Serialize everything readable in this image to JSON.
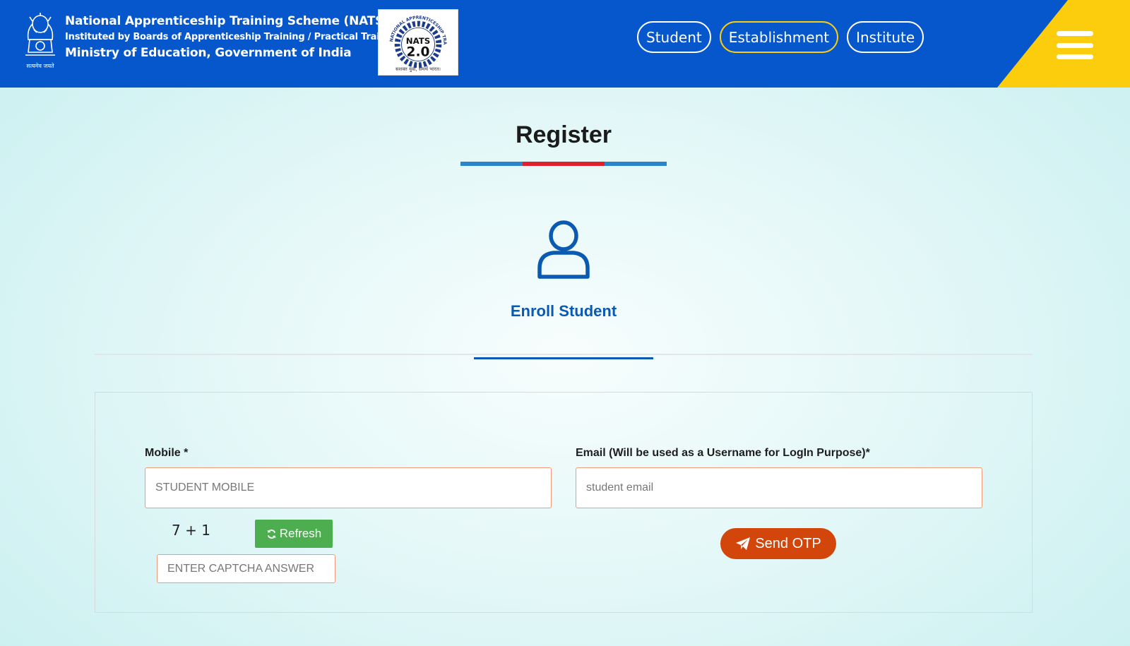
{
  "header": {
    "title_line1": "National Apprenticeship Training Scheme (NATS)",
    "title_line2": "Instituted by Boards of Apprenticeship Training / Practical Training",
    "title_line3": "Ministry of Education, Government of India",
    "emblem_motto": "सत्यमेव जयते",
    "logo": {
      "ring_text": "NATIONAL APPRENTICESHIP TRAINING SCHEME",
      "name": "NATS",
      "version": "2.0",
      "tagline": "सशक्त युवा, समर्थ भारत।"
    },
    "nav": [
      {
        "label": "Student",
        "active": false
      },
      {
        "label": "Establishment",
        "active": true
      },
      {
        "label": "Institute",
        "active": false
      }
    ],
    "colors": {
      "primary": "#0656cc",
      "accent": "#fccd0c"
    }
  },
  "page": {
    "title": "Register",
    "tab_label": "Enroll Student",
    "tab_icon": "user-icon"
  },
  "form": {
    "mobile_label": "Mobile *",
    "mobile_placeholder": "STUDENT MOBILE",
    "email_label": "Email (Will be used as a Username for LogIn Purpose)*",
    "email_placeholder": "student email",
    "captcha_question": "7 + 1",
    "refresh_label": "Refresh",
    "refresh_icon": "refresh-icon",
    "captcha_placeholder": "ENTER CAPTCHA ANSWER",
    "send_label": "Send OTP",
    "send_icon": "paper-plane-icon"
  }
}
